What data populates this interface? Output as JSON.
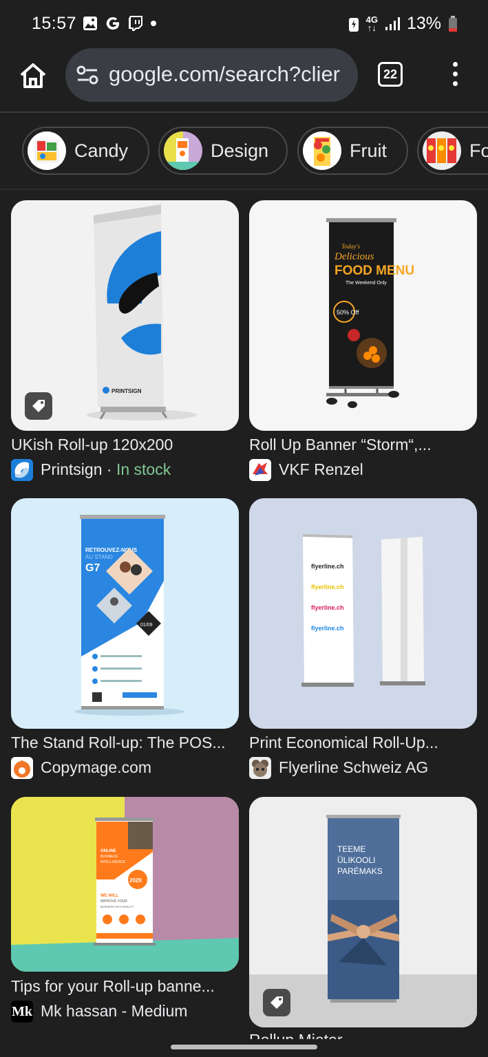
{
  "status_bar": {
    "time": "15:57",
    "network": "4G",
    "battery": "13%"
  },
  "address_bar": {
    "url": "google.com/search?clier",
    "tab_count": "22"
  },
  "chips": [
    {
      "label": "Candy"
    },
    {
      "label": "Design"
    },
    {
      "label": "Fruit"
    },
    {
      "label": "Fo"
    }
  ],
  "results": [
    {
      "title": "UKish Roll-up 120x200",
      "source": "Printsign",
      "separator": " · ",
      "stock": "In stock",
      "logo_text": "PRINTSIGN"
    },
    {
      "title": "Roll Up Banner “Storm“,...",
      "source": "VKF Renzel",
      "banner_text": [
        "Today's",
        "Delicious",
        "FOOD MENU",
        "The Weekend Only",
        "50% Off"
      ]
    },
    {
      "title": "The Stand Roll-up: The POS...",
      "source": "Copymage.com",
      "banner_text": [
        "RETROUVEZ-NOUS",
        "AU STAND",
        "G7",
        "01/09"
      ]
    },
    {
      "title": "Print Economical Roll-Up...",
      "source": "Flyerline Schweiz AG",
      "banner_text": [
        "flyerline.ch",
        "flyerline.ch",
        "flyerline.ch",
        "flyerline.ch"
      ]
    },
    {
      "title": "Tips for your Roll-up banne...",
      "source": "Mk hassan - Medium",
      "favicon_text": "Mk",
      "banner_text": [
        "ONLINE",
        "BUSINESS",
        "INTELLIGENCE",
        "2020",
        "WE WILL",
        "IMPROVE YOUR",
        "BUSINESS INTO REALITY"
      ]
    },
    {
      "title": "Rollup Mieter...",
      "source": "",
      "banner_text": [
        "TEEME",
        "ÜLIKOOLI",
        "PARÉMAKS"
      ]
    }
  ],
  "colors": {
    "background": "#1f1f1f",
    "stock_green": "#81c995",
    "url_pill": "#3a3d44"
  }
}
